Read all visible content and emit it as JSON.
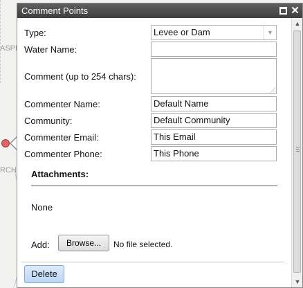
{
  "map": {
    "labels": [
      "ASPE",
      "RCH"
    ]
  },
  "popup": {
    "title": "Comment Points",
    "icons": {
      "maximize": "maximize-icon",
      "close": "close-icon"
    }
  },
  "form": {
    "type_label": "Type:",
    "type_value": "Levee or Dam",
    "water_name_label": "Water Name:",
    "water_name_value": "",
    "comment_label": "Comment (up to 254 chars):",
    "comment_value": "",
    "commenter_name_label": "Commenter Name:",
    "commenter_name_value": "Default Name",
    "community_label": "Community:",
    "community_value": "Default Community",
    "commenter_email_label": "Commenter Email:",
    "commenter_email_value": "This Email",
    "commenter_phone_label": "Commenter Phone:",
    "commenter_phone_value": "This Phone"
  },
  "attachments": {
    "title": "Attachments:",
    "none_text": "None",
    "add_label": "Add:",
    "browse_label": "Browse...",
    "file_status": "No file selected."
  },
  "actions": {
    "delete_label": "Delete"
  }
}
